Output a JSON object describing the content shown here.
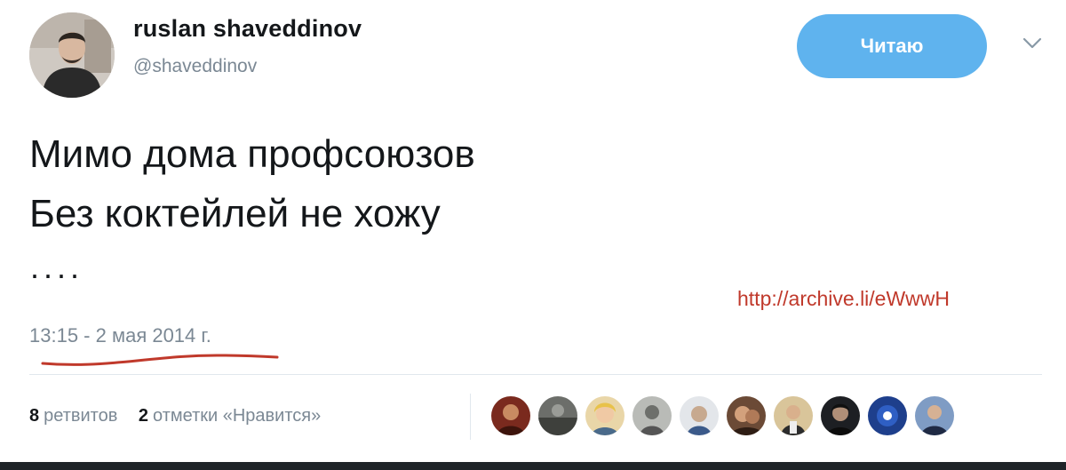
{
  "user": {
    "name": "ruslan shaveddinov",
    "handle": "@shaveddinov"
  },
  "follow_button": {
    "label": "Читаю"
  },
  "tweet": {
    "lines": [
      "Мимо дома профсоюзов",
      "Без коктейлей не хожу"
    ],
    "ellipsis": "....",
    "timestamp": "13:15 - 2 мая 2014 г.",
    "archive_link": "http://archive.li/eWwwH"
  },
  "stats": {
    "retweets_count": "8",
    "retweets_label": "ретвитов",
    "likes_count": "2",
    "likes_label": "отметки «Нравится»"
  },
  "colors": {
    "follow_button": "#5fb3ee",
    "annotation_red": "#c0392b",
    "muted_text": "#7b8894"
  }
}
